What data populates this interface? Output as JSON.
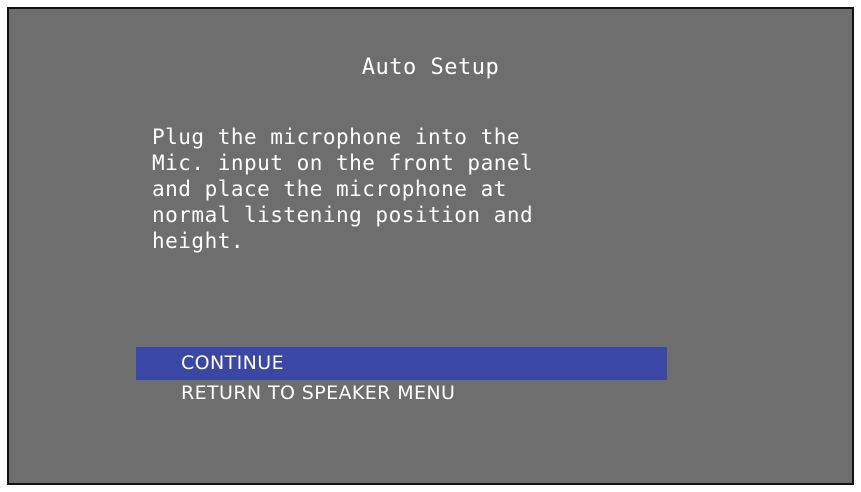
{
  "screen": {
    "title": "Auto Setup",
    "instructions": "Plug the microphone into the\nMic. input on the front panel\nand place the microphone at\nnormal listening position and\nheight."
  },
  "menu": {
    "items": [
      {
        "label": "CONTINUE",
        "selected": true
      },
      {
        "label": "RETURN TO SPEAKER MENU",
        "selected": false
      }
    ],
    "highlight_color": "#3b47a5"
  },
  "colors": {
    "background": "#6e6e6e",
    "text": "#ffffff",
    "border": "#111111"
  }
}
